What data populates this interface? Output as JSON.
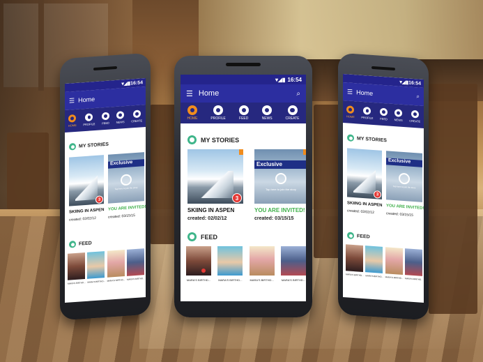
{
  "app": {
    "status_time": "16:54",
    "title": "Home",
    "tabs": [
      {
        "label": "HOME",
        "icon": "home-shutter-icon",
        "active": true
      },
      {
        "label": "PROFILE",
        "icon": "profile-shutter-icon",
        "active": false
      },
      {
        "label": "FEED",
        "icon": "feed-shutter-icon",
        "active": false
      },
      {
        "label": "NEWS",
        "icon": "news-shutter-icon",
        "active": false
      },
      {
        "label": "CREATE",
        "icon": "create-shutter-icon",
        "active": false
      }
    ],
    "sections": {
      "stories_title": "MY STORIES",
      "feed_title": "FEED"
    },
    "stories": [
      {
        "title": "SKIING IN ASPEN",
        "date": "created: 02/02/12",
        "badge": "3"
      },
      {
        "title": "YOU ARE INVITED!",
        "date": "created: 03/15/15",
        "banner": "Exclusive",
        "tap_text": "Tap here to join the story"
      }
    ],
    "feed_items": [
      {
        "caption": "MARA'S BIRTHD..."
      },
      {
        "caption": "MARA'S BIRTHD..."
      },
      {
        "caption": "MARA'S BIRTHD..."
      },
      {
        "caption": "MARA'S BIRTHD..."
      }
    ]
  },
  "colors": {
    "status_bar": "#24248c",
    "app_bar": "#2c2ea0",
    "tab_bar": "#26287f",
    "accent_orange": "#f08c1e",
    "accent_green": "#3fb04a",
    "badge_red": "#e53935"
  }
}
